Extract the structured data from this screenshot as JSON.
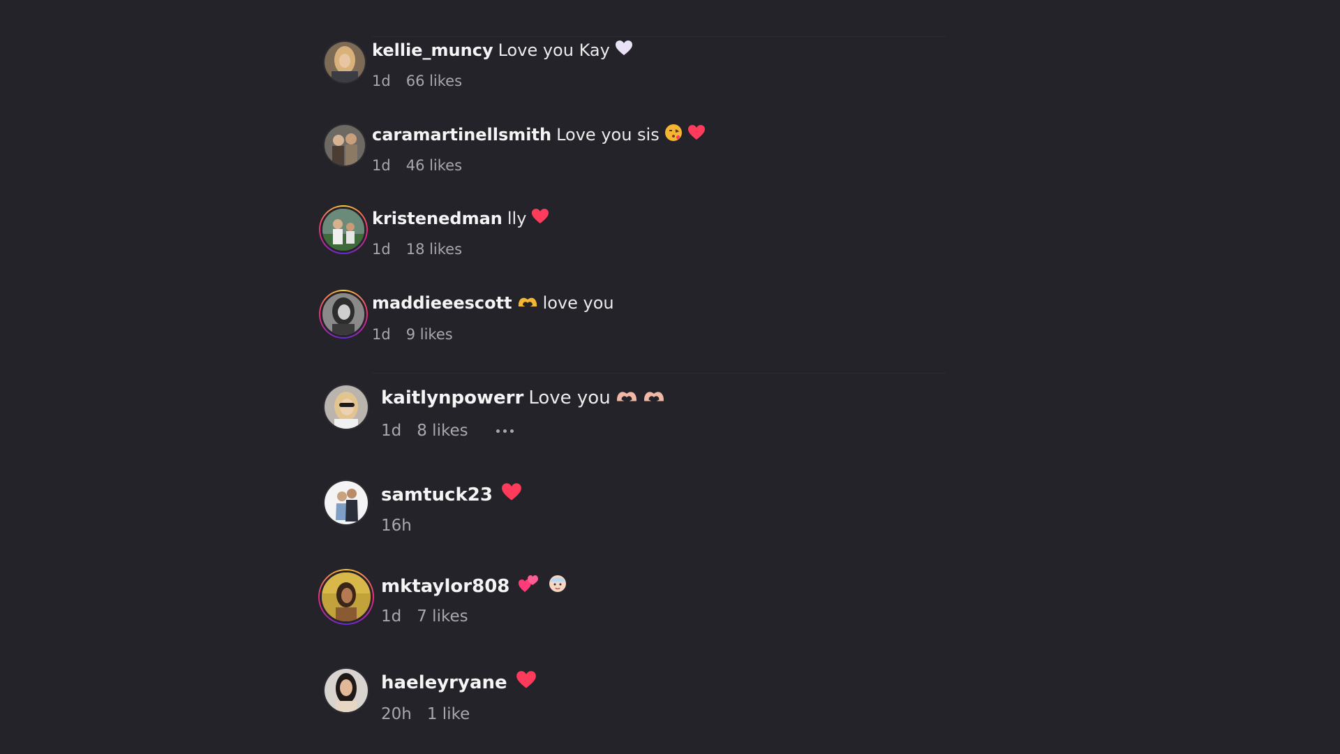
{
  "comments": [
    {
      "user": "kellie_muncy",
      "text": "Love you Kay",
      "emoji_after": [
        "white-heart-icon"
      ],
      "time": "1d",
      "likes": "66 likes"
    },
    {
      "user": "caramartinellsmith",
      "text": "Love you sis",
      "emoji_after": [
        "kissing-face-icon",
        "red-heart-icon"
      ],
      "time": "1d",
      "likes": "46 likes"
    },
    {
      "user": "kristenedman",
      "text": "lly",
      "emoji_after": [
        "red-heart-icon"
      ],
      "time": "1d",
      "likes": "18 likes"
    },
    {
      "user": "maddieeescott",
      "emoji_before_text": [
        "heart-hands-icon"
      ],
      "text": "love you",
      "time": "1d",
      "likes": "9 likes"
    },
    {
      "user": "kaitlynpowerr",
      "text": "Love you",
      "emoji_after": [
        "heart-hands-icon",
        "heart-hands-icon"
      ],
      "time": "1d",
      "likes": "8 likes",
      "has_more_menu": true
    },
    {
      "user": "samtuck23",
      "text": "",
      "emoji_after": [
        "red-heart-icon"
      ],
      "time": "16h",
      "likes": ""
    },
    {
      "user": "mktaylor808",
      "text": "",
      "emoji_after": [
        "two-hearts-icon",
        "baby-icon"
      ],
      "time": "1d",
      "likes": "7 likes"
    },
    {
      "user": "haeleyryane",
      "text": "",
      "emoji_after": [
        "red-heart-icon"
      ],
      "time": "20h",
      "likes": "1 like"
    }
  ],
  "colors": {
    "background": "#232329",
    "username": "#f5f5f5",
    "meta": "#a8a8ae",
    "heart": "#ff3b5c",
    "story_ring": [
      "#f9ce34",
      "#ee2a7b",
      "#6228d7"
    ]
  }
}
